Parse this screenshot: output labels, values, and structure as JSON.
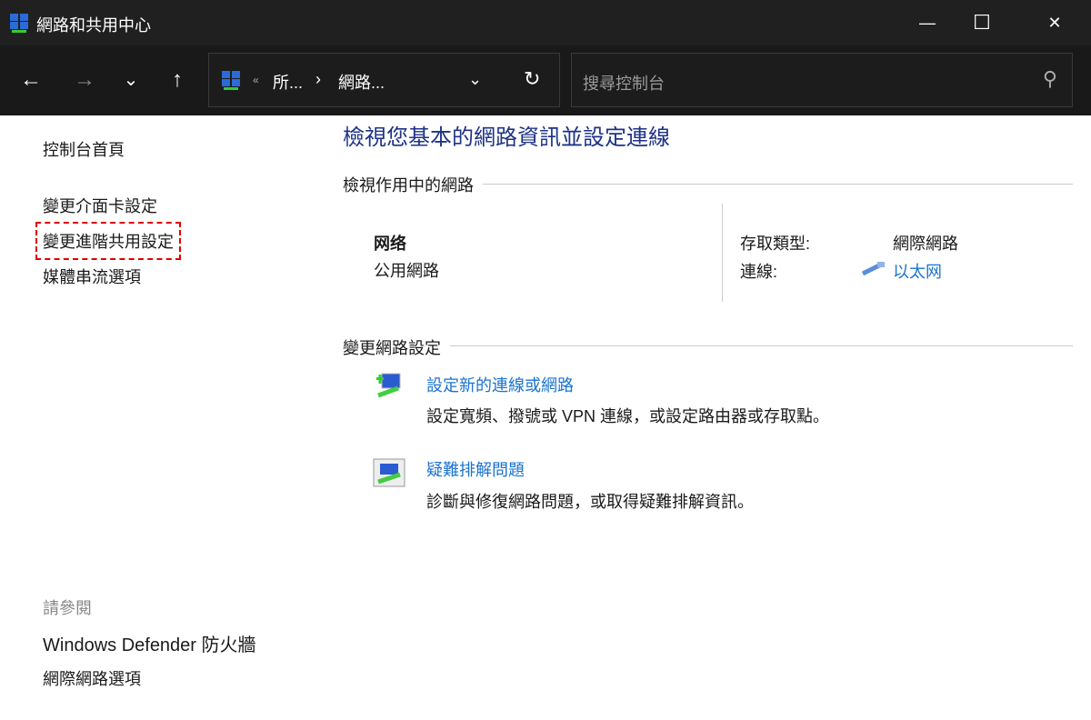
{
  "window": {
    "title": "網路和共用中心",
    "minimize": "—",
    "maximize": "☐",
    "close": "✕"
  },
  "nav": {
    "back": "←",
    "forward": "→",
    "recent": "⌄",
    "up": "↑",
    "crumb_sep1": "«",
    "crumb1": "所...",
    "crumb_sep2": "›",
    "crumb2": "網路...",
    "dropdown": "⌄",
    "refresh": "↻",
    "search_placeholder": "搜尋控制台",
    "search_icon": "⚲"
  },
  "sidebar": {
    "home": "控制台首頁",
    "items": [
      "變更介面卡設定",
      "變更進階共用設定",
      "媒體串流選項"
    ],
    "see_also": "請參閱",
    "see_also_items": [
      "Windows Defender 防火牆",
      "網際網路選項"
    ]
  },
  "main": {
    "title": "檢視您基本的網路資訊並設定連線",
    "active_header": "檢視作用中的網路",
    "network_name": "网络",
    "network_type": "公用網路",
    "access_label": "存取類型:",
    "access_value": "網際網路",
    "conn_label": "連線:",
    "conn_value": "以太网",
    "change_header": "變更網路設定",
    "tasks": [
      {
        "title": "設定新的連線或網路",
        "desc": "設定寬頻、撥號或 VPN 連線，或設定路由器或存取點。"
      },
      {
        "title": "疑難排解問題",
        "desc": "診斷與修復網路問題，或取得疑難排解資訊。"
      }
    ]
  }
}
